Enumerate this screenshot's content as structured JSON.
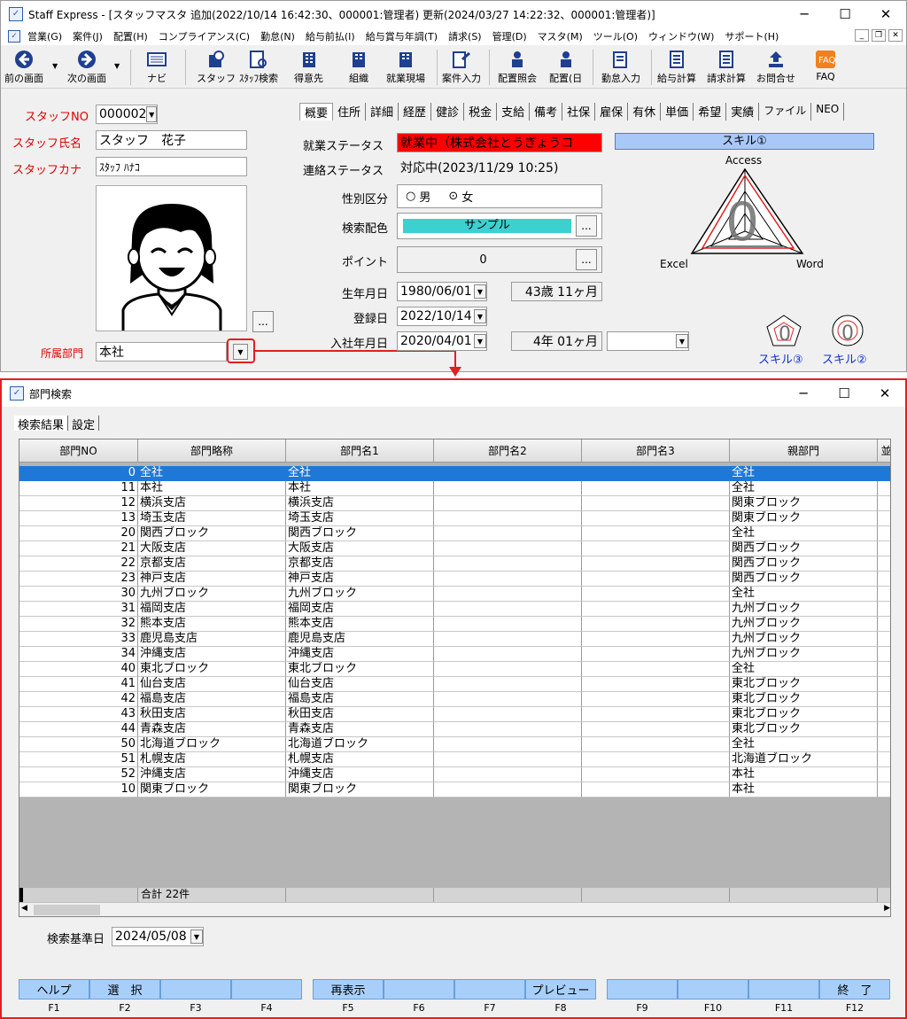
{
  "main": {
    "title": "Staff Express - [スタッフマスタ  追加(2022/10/14 16:42:30、000001:管理者)  更新(2024/03/27 14:22:32、000001:管理者)]",
    "menu": [
      "営業(G)",
      "案件(J)",
      "配置(H)",
      "コンプライアンス(C)",
      "勤怠(N)",
      "給与前払(I)",
      "給与賞与年調(T)",
      "請求(S)",
      "管理(D)",
      "マスタ(M)",
      "ツール(O)",
      "ウィンドウ(W)",
      "サポート(H)"
    ],
    "toolbar": {
      "prev": "前の画面",
      "next": "次の画面",
      "navi": "ナビ",
      "staff": "スタッフ",
      "staff_search": "ｽﾀｯﾌ検索",
      "customer": "得意先",
      "org": "組織",
      "worksite": "就業現場",
      "job_entry": "案件入力",
      "assign_inquiry": "配置照会",
      "assign_day": "配置(日",
      "attendance": "勤怠入力",
      "payroll": "給与計算",
      "billing": "請求計算",
      "contact": "お問合せ",
      "faq": "FAQ"
    },
    "staff_no_label": "スタッフNO",
    "staff_no": "000002",
    "staff_name_label": "スタッフ氏名",
    "staff_name": "スタッフ　花子",
    "staff_kana_label": "スタッフカナ",
    "staff_kana": "ｽﾀｯﾌ ﾊﾅｺ",
    "photo_btn": "...",
    "dept_label": "所属部門",
    "dept_value": "本社",
    "tabs": [
      "概要",
      "住所",
      "詳細",
      "経歴",
      "健診",
      "税金",
      "支給",
      "備考",
      "社保",
      "雇保",
      "有休",
      "単価",
      "希望",
      "実績",
      "ファイル",
      "NEO"
    ],
    "work_status_label": "就業ステータス",
    "work_status": "就業中（株式会社とうぎょうコ",
    "contact_status_label": "連絡ステータス",
    "contact_status": "対応中(2023/11/29 10:25)",
    "gender_label": "性別区分",
    "gender_male": "男",
    "gender_female": "女",
    "search_color_label": "検索配色",
    "search_color_sample": "サンプル",
    "point_label": "ポイント",
    "point_value": "0",
    "birth_label": "生年月日",
    "birth_value": "1980/06/01",
    "age_value": "43歳 11ヶ月",
    "reg_label": "登録日",
    "reg_value": "2022/10/14",
    "join_label": "入社年月日",
    "join_value": "2020/04/01",
    "tenure_value": "4年 01ヶ月",
    "skill_header": "スキル①",
    "skill_labels": {
      "top": "Access",
      "left": "Excel",
      "right": "Word",
      "score": "0"
    },
    "skill3": "スキル③",
    "skill2": "スキル②",
    "colors": {
      "status_red": "#ff0000",
      "sample_cyan": "#3cd0d0",
      "skill_header": "#a8c8f8"
    }
  },
  "dialog": {
    "title": "部門検索",
    "tabs": [
      "検索結果",
      "設定"
    ],
    "columns": [
      "部門NO",
      "部門略称",
      "部門名1",
      "部門名2",
      "部門名3",
      "親部門",
      "並"
    ],
    "rows": [
      [
        "0",
        "全社",
        "全社",
        "",
        "",
        "全社"
      ],
      [
        "11",
        "本社",
        "本社",
        "",
        "",
        "全社"
      ],
      [
        "12",
        "横浜支店",
        "横浜支店",
        "",
        "",
        "関東ブロック"
      ],
      [
        "13",
        "埼玉支店",
        "埼玉支店",
        "",
        "",
        "関東ブロック"
      ],
      [
        "20",
        "関西ブロック",
        "関西ブロック",
        "",
        "",
        "全社"
      ],
      [
        "21",
        "大阪支店",
        "大阪支店",
        "",
        "",
        "関西ブロック"
      ],
      [
        "22",
        "京都支店",
        "京都支店",
        "",
        "",
        "関西ブロック"
      ],
      [
        "23",
        "神戸支店",
        "神戸支店",
        "",
        "",
        "関西ブロック"
      ],
      [
        "30",
        "九州ブロック",
        "九州ブロック",
        "",
        "",
        "全社"
      ],
      [
        "31",
        "福岡支店",
        "福岡支店",
        "",
        "",
        "九州ブロック"
      ],
      [
        "32",
        "熊本支店",
        "熊本支店",
        "",
        "",
        "九州ブロック"
      ],
      [
        "33",
        "鹿児島支店",
        "鹿児島支店",
        "",
        "",
        "九州ブロック"
      ],
      [
        "34",
        "沖縄支店",
        "沖縄支店",
        "",
        "",
        "九州ブロック"
      ],
      [
        "40",
        "東北ブロック",
        "東北ブロック",
        "",
        "",
        "全社"
      ],
      [
        "41",
        "仙台支店",
        "仙台支店",
        "",
        "",
        "東北ブロック"
      ],
      [
        "42",
        "福島支店",
        "福島支店",
        "",
        "",
        "東北ブロック"
      ],
      [
        "43",
        "秋田支店",
        "秋田支店",
        "",
        "",
        "東北ブロック"
      ],
      [
        "44",
        "青森支店",
        "青森支店",
        "",
        "",
        "東北ブロック"
      ],
      [
        "50",
        "北海道ブロック",
        "北海道ブロック",
        "",
        "",
        "全社"
      ],
      [
        "51",
        "札幌支店",
        "札幌支店",
        "",
        "",
        "北海道ブロック"
      ],
      [
        "52",
        "沖縄支店",
        "沖縄支店",
        "",
        "",
        "本社"
      ],
      [
        "10",
        "関東ブロック",
        "関東ブロック",
        "",
        "",
        "本社"
      ]
    ],
    "selected_row": 0,
    "total": "合計 22件",
    "base_date_label": "検索基準日",
    "base_date": "2024/05/08",
    "fkeys": [
      {
        "label": "ヘルプ",
        "key": "F1"
      },
      {
        "label": "選　択",
        "key": "F2"
      },
      {
        "label": "",
        "key": "F3"
      },
      {
        "label": "",
        "key": "F4"
      },
      {
        "label": "再表示",
        "key": "F5"
      },
      {
        "label": "",
        "key": "F6"
      },
      {
        "label": "",
        "key": "F7"
      },
      {
        "label": "プレビュー",
        "key": "F8"
      },
      {
        "label": "",
        "key": "F9"
      },
      {
        "label": "",
        "key": "F10"
      },
      {
        "label": "",
        "key": "F11"
      },
      {
        "label": "終　了",
        "key": "F12"
      }
    ]
  }
}
